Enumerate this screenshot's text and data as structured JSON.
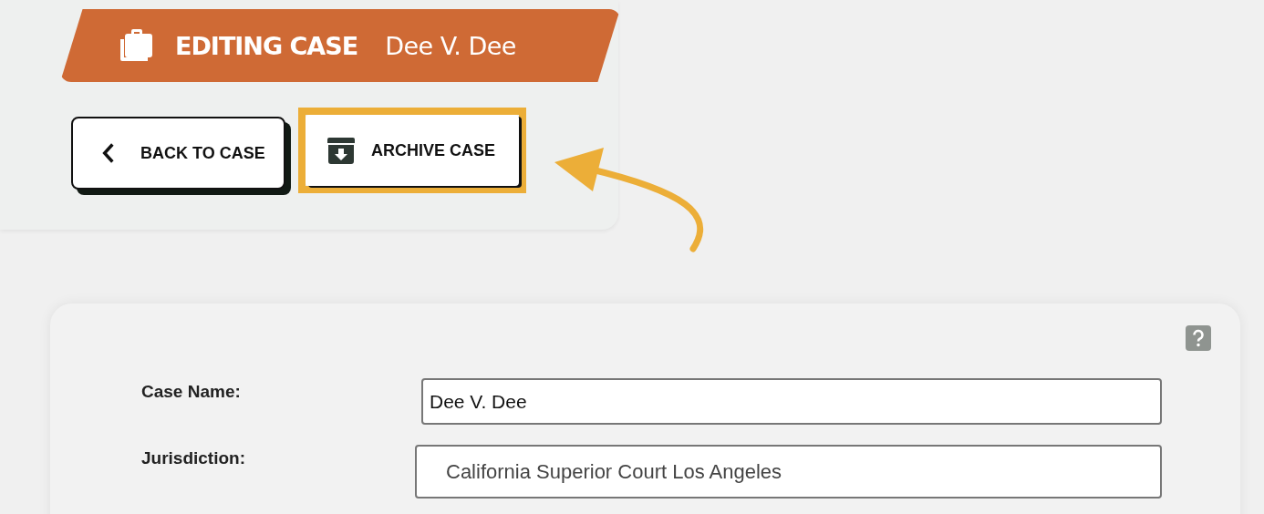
{
  "header": {
    "title": "EDITING CASE",
    "case_name": "Dee V. Dee"
  },
  "actions": [
    {
      "kind": "back",
      "label": "BACK TO CASE",
      "highlighted": false
    },
    {
      "kind": "archive",
      "label": "ARCHIVE CASE",
      "highlighted": true
    }
  ],
  "form": {
    "fields": [
      {
        "kind": "text",
        "label": "Case Name:",
        "value": "Dee V. Dee"
      },
      {
        "kind": "select",
        "label": "Jurisdiction:",
        "value": "California Superior Court Los Angeles"
      }
    ]
  }
}
